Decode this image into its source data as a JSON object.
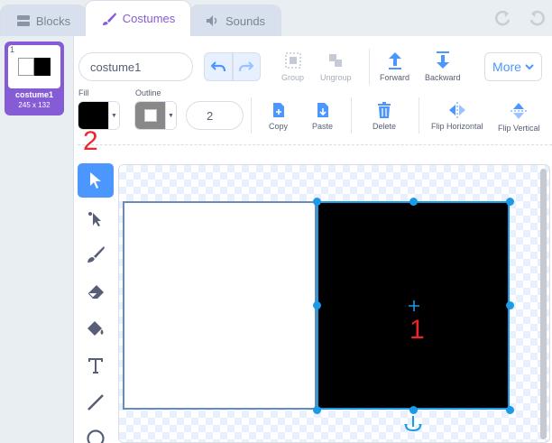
{
  "tabs": {
    "blocks": "Blocks",
    "costumes": "Costumes",
    "sounds": "Sounds"
  },
  "costume_list": {
    "items": [
      {
        "number": "1",
        "name": "costume1",
        "size": "245 x 132"
      }
    ]
  },
  "toolbar": {
    "costume_name": "costume1",
    "group": "Group",
    "ungroup": "Ungroup",
    "forward": "Forward",
    "backward": "Backward",
    "more": "More",
    "fill_label": "Fill",
    "outline_label": "Outline",
    "stroke_width": "2",
    "copy": "Copy",
    "paste": "Paste",
    "delete": "Delete",
    "flip_horizontal": "Flip Horizontal",
    "flip_vertical": "Flip Vertical"
  },
  "colors": {
    "accent": "#855cd6",
    "blue": "#4c97ff",
    "selection": "#1c9ae6",
    "fill": "#000000",
    "outline": "#888888"
  },
  "tools": [
    "select-icon",
    "reshape-icon",
    "brush-icon",
    "eraser-icon",
    "fill-icon",
    "text-icon",
    "line-icon",
    "circle-icon"
  ],
  "annotations": {
    "one": "1",
    "two": "2"
  }
}
